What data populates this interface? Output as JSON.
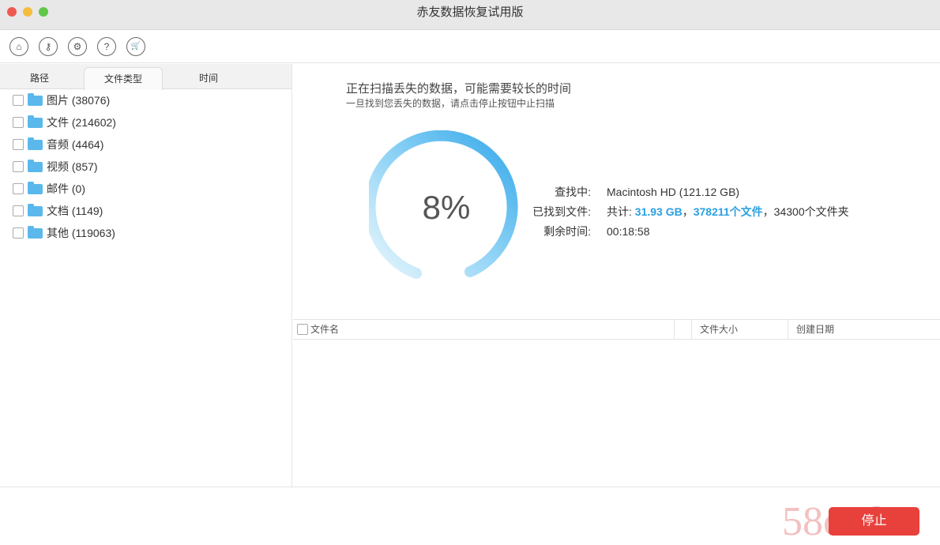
{
  "window": {
    "title": "赤友数据恢复试用版"
  },
  "toolbar": {
    "icons": [
      "home-icon",
      "key-icon",
      "gear-icon",
      "help-icon",
      "cart-icon"
    ],
    "glyphs": [
      "⌂",
      "⚷",
      "⚙",
      "?",
      "🛒"
    ]
  },
  "tabs": [
    "路径",
    "文件类型",
    "时间"
  ],
  "categories": [
    {
      "label": "图片 (38076)"
    },
    {
      "label": "文件 (214602)"
    },
    {
      "label": "音频 (4464)"
    },
    {
      "label": "视频 (857)"
    },
    {
      "label": "邮件 (0)"
    },
    {
      "label": "文档 (1149)"
    },
    {
      "label": "其他 (119063)"
    }
  ],
  "scan": {
    "heading": "正在扫描丢失的数据，可能需要较长的时间",
    "subheading": "一旦找到您丢失的数据，请点击停止按钮中止扫描",
    "progress_percent": 8,
    "progress_label": "8%",
    "searching_label": "查找中:",
    "searching_value": "Macintosh HD (121.12 GB)",
    "found_label": "已找到文件:",
    "found_prefix": "共计: ",
    "found_size": "31.93 GB",
    "sep1": "，",
    "found_files": "378211个文件",
    "sep2": "，",
    "found_folders": "34300个文件夹",
    "remaining_label": "剩余时间:",
    "remaining_value": "00:18:58"
  },
  "table": {
    "columns": [
      "文件名",
      "文件大小",
      "创建日期"
    ]
  },
  "footer": {
    "stop_label": "停止",
    "watermark": "58codes"
  },
  "colors": {
    "accent": "#2aa0e0",
    "stop": "#e8413c"
  }
}
